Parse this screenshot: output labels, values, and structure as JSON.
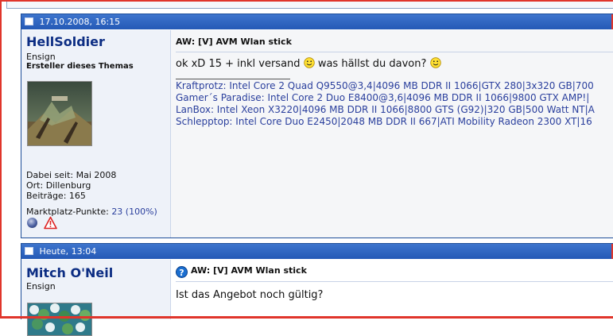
{
  "posts": [
    {
      "date": "17.10.2008, 16:15",
      "username": "HellSoldier",
      "user_title": "Ensign",
      "thread_starter": "Ersteller dieses Themas",
      "joined": "Dabei seit: Mai 2008",
      "location": "Ort: Dillenburg",
      "post_count": "Beiträge: 165",
      "market_label": "Marktplatz-Punkte:",
      "market_value": "23 (100%)",
      "title": "AW: [V] AVM Wlan stick",
      "message_part1": "ok xD 15 + inkl versand",
      "message_part2": "was hällst du davon?",
      "signature": [
        "Kraftprotz: Intel Core 2 Quad Q9550@3,4|4096 MB DDR II 1066|GTX 280|3x320 GB|700",
        "Gamer´s Paradise: Intel Core 2 Duo E8400@3,6|4096 MB DDR II 1066|9800 GTX AMP!|",
        "LanBox: Intel Xeon X3220|4096 MB DDR II 1066|8800 GTS (G92)|320 GB|500 Watt NT|A",
        "Schlepptop: Intel Core Duo E2450|2048 MB DDR II 667|ATI Mobility Radeon 2300 XT|16"
      ],
      "icons": [
        "online-status-icon",
        "report-post-icon"
      ]
    },
    {
      "date": "Heute, 13:04",
      "username": "Mitch O'Neil",
      "user_title": "Ensign",
      "title": "AW: [V] AVM Wlan stick",
      "title_icon": "?",
      "message": "Ist das Angebot noch gültig?"
    }
  ],
  "colors": {
    "header_blue": "#2c62c0",
    "username": "#0c2d83",
    "link": "#2a3f9d",
    "frame_red": "#e0352b"
  }
}
